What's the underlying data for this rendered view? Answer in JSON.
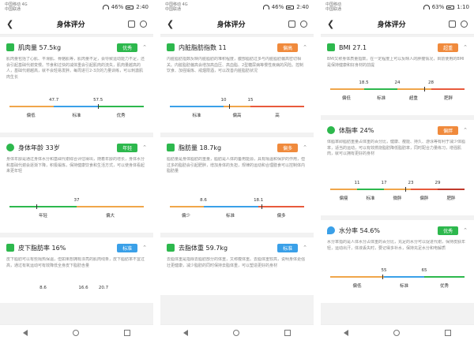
{
  "screens": [
    {
      "status": {
        "carrier1": "中国移动 4G",
        "carrier2": "中国联通",
        "battery": "46%",
        "time": "2:40"
      },
      "title": "身体评分",
      "cards": [
        {
          "title": "肌肉量 57.5kg",
          "badge": "优秀",
          "badge_color": "#2db84d",
          "icon_color": "#2db84d",
          "desc": "肌肉量包括了心肌、平滑肌、骨骼肌等，肌肉量不足，会导致运动能力不足，还会引起基础代谢变慢。节食和过快的减体重会引起肌肉的流失，肌肉量越高的人，基础代谢越高，就不会轻易发胖。每周进行2-3次的力量训练，可以刺激肌肉生长",
          "ticks": [
            "47.7",
            "57.5"
          ],
          "labels": [
            "偏低",
            "标准",
            "优秀"
          ]
        },
        {
          "title": "身体年龄 33岁",
          "badge": "年轻",
          "badge_color": "#2db84d",
          "icon_color": "#2db84d",
          "desc": "身体年龄是通过身体水分和基础代谢综合评估得出，随着年龄的增长，身体水分和基础代谢会逐渐下降，积极锻炼，保持健康饮食和生活方式，可以使身体看起来更年轻",
          "ticks": [
            "37"
          ],
          "labels": [
            "年轻",
            "偏大"
          ]
        },
        {
          "title": "皮下脂肪率 16%",
          "badge": "标准",
          "badge_color": "#3aa0e8",
          "icon_color": "#2db84d",
          "desc": "皮下脂肪可以有些隔热保温，但如果想拥有漂亮的肌肉线条，皮下脂肪率不宜过高，通过有氧运动可有效降低全身皮下脂肪含量",
          "ticks": [
            "8.6",
            "16.6",
            "20.7"
          ],
          "labels": []
        }
      ]
    },
    {
      "status": {
        "carrier1": "中国移动 4G",
        "carrier2": "中国联通",
        "battery": "46%",
        "time": "2:40"
      },
      "title": "身体评分",
      "cards": [
        {
          "title": "内脏脂肪指数 11",
          "badge": "偏高",
          "badge_color": "#f08a3c",
          "icon_color": "#2db84d",
          "desc": "内脏脂肪指数反映内脏脂肪的堆积程度，腹部脂肪过多与内脏脂肪偏高密切相关。内脏脂肪偏高会增加高血压、高血脂、2型糖尿病等慢性疾病的风险。控制饮食、加强锻炼、戒烟限酒，可以改善内脏脂肪状况",
          "ticks": [
            "10",
            "15"
          ],
          "labels": [
            "标准",
            "偏高",
            "高"
          ]
        },
        {
          "title": "脂肪量 18.7kg",
          "badge": "偏多",
          "badge_color": "#f08a3c",
          "icon_color": "#2db84d",
          "desc": "脂肪量是身体脂肪的重量，脂肪是人体的备用能源，具有隔温和保护的作用，但过多的脂肪会引起肥胖，增加身体的负担，规律的运动和合理膳食可以控制体内脂肪量",
          "ticks": [
            "8.6",
            "18.1"
          ],
          "labels": [
            "偏少",
            "标准",
            "偏多"
          ]
        },
        {
          "title": "去脂体重 59.7kg",
          "badge": "标准",
          "badge_color": "#3aa0e8",
          "icon_color": "#2db84d",
          "desc": "去脂体重是指除去脂肪部分的体重，又称瘦体重。去脂体重较高，说明身体更强壮更健康，减少脂肪的同时保持去脂体重，可以塑造更好的身材",
          "ticks": [],
          "labels": []
        }
      ]
    },
    {
      "status": {
        "carrier1": "中国移动",
        "carrier2": "中国联通",
        "battery": "63%",
        "time": "1:10"
      },
      "title": "身体评分",
      "cards": [
        {
          "title": "BMI 27.1",
          "badge": "超重",
          "badge_color": "#f08a3c",
          "icon_color": "#2db84d",
          "desc": "BMI又称身体质量指数，在一定程度上可以反映人的胖瘦情况，目前使用的BMI是保持健康和好身材的前提",
          "ticks": [
            "18.5",
            "24",
            "28"
          ],
          "labels": [
            "偏低",
            "标准",
            "超重",
            "肥胖"
          ]
        },
        {
          "title": "体脂率 24%",
          "badge": "偏胖",
          "badge_color": "#f08a3c",
          "icon_color": "#2db84d",
          "desc": "体脂率即脂肪重量占体重的百分比，健康、瘦能、持久、游泳等有利于减少体脂率，适当的运动，可以有效燃烧脂肪降低脂肪率，同时配合力量练习，增强肌肉，就可以拥有更好的身材",
          "ticks": [
            "11",
            "17",
            "23",
            "29"
          ],
          "labels": [
            "偏瘦",
            "标准",
            "微胖",
            "偏胖",
            "肥胖"
          ]
        },
        {
          "title": "水分率 54.6%",
          "badge": "优秀",
          "badge_color": "#2db84d",
          "icon_color": "#3aa0e8",
          "desc": "水分率指的是人体水分占体重的百分比，充足的水分可以促进代谢，保持皮肤年轻，运动出汗，体液丢失时，要记得多补水，保持充足水分和电解质",
          "ticks": [
            "55",
            "65"
          ],
          "labels": [
            "偏低",
            "标准",
            "优秀"
          ]
        }
      ]
    }
  ]
}
